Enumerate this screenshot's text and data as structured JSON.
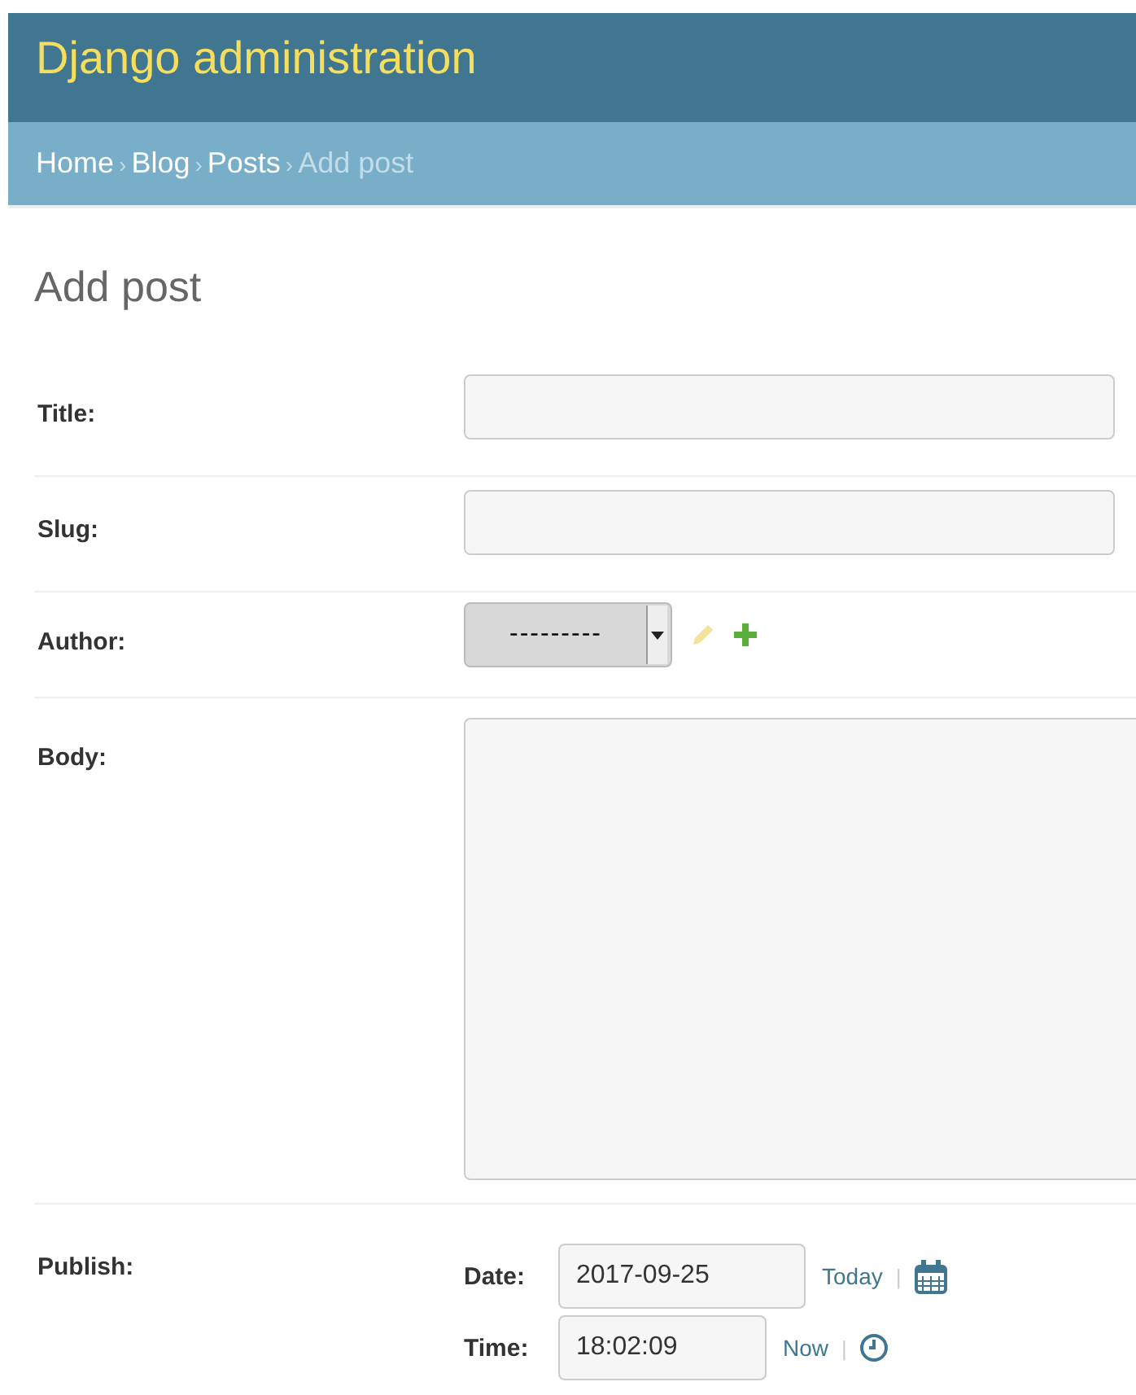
{
  "header": {
    "title": "Django administration"
  },
  "breadcrumbs": [
    {
      "label": "Home",
      "current": false
    },
    {
      "label": "Blog",
      "current": false
    },
    {
      "label": "Posts",
      "current": false
    },
    {
      "label": "Add post",
      "current": true
    }
  ],
  "breadcrumb_separator": "›",
  "page_title": "Add post",
  "fields": [
    {
      "kind": "text",
      "label": "Title:"
    },
    {
      "kind": "text",
      "label": "Slug:"
    },
    {
      "kind": "select",
      "label": "Author:",
      "value": "---------"
    },
    {
      "kind": "textarea",
      "label": "Body:"
    },
    {
      "kind": "datetime",
      "label": "Publish:",
      "date_label": "Date:",
      "date_value": "2017-09-25",
      "date_shortcut": "Today",
      "time_label": "Time:",
      "time_value": "18:02:09",
      "time_shortcut": "Now",
      "separator": "|"
    }
  ]
}
